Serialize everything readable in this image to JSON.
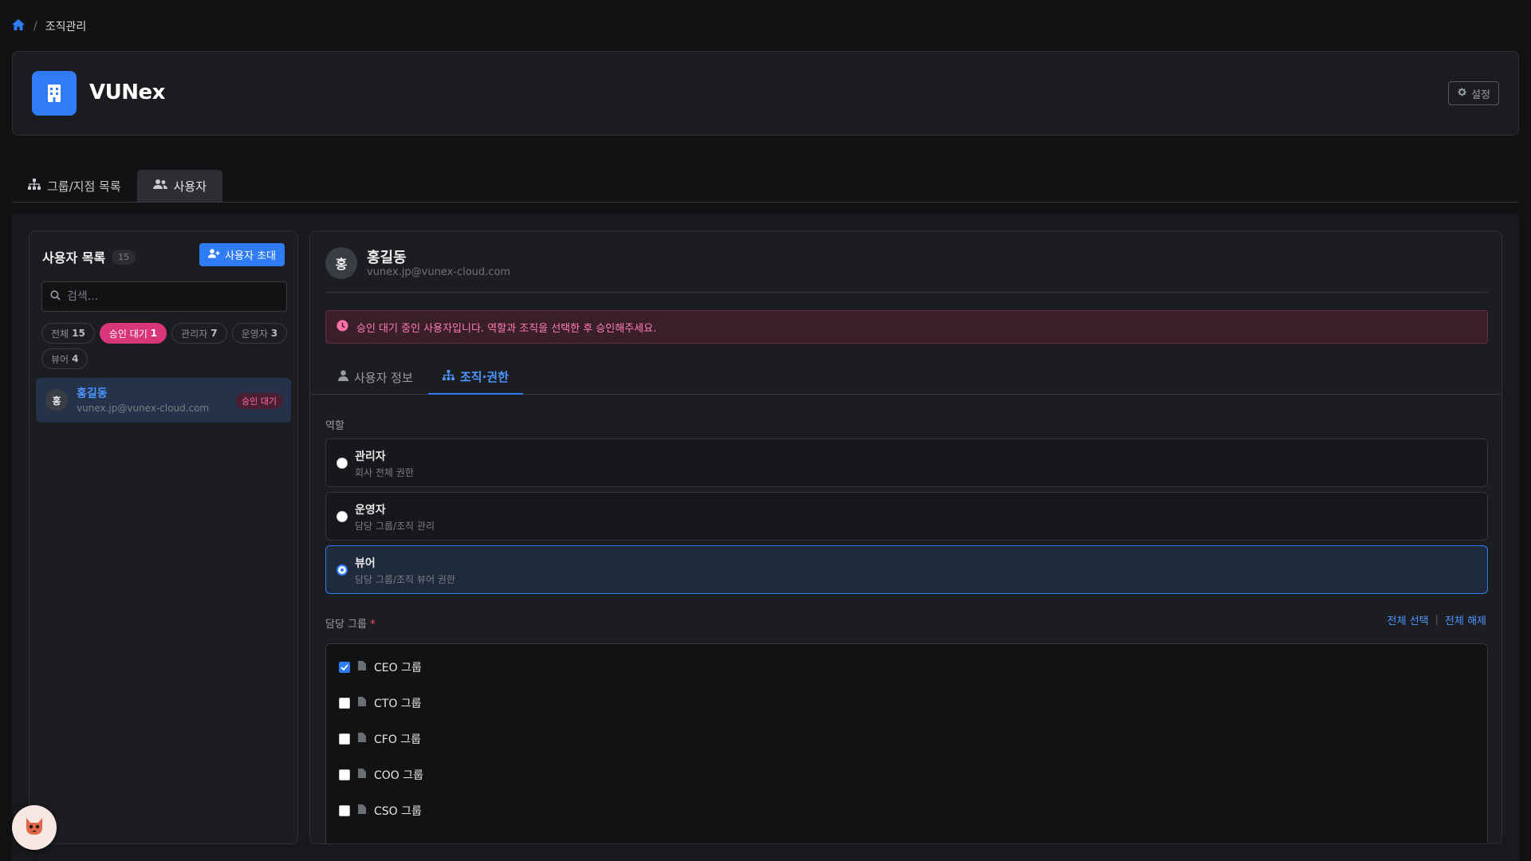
{
  "breadcrumb": {
    "separator": "/",
    "current": "조직관리"
  },
  "org": {
    "name": "VUNex",
    "settings_label": "설정"
  },
  "tabs": [
    {
      "label": "그룹/지점 목록",
      "icon": "sitemap-icon"
    },
    {
      "label": "사용자",
      "icon": "users-icon"
    }
  ],
  "user_list": {
    "title": "사용자 목록",
    "count": "15",
    "invite_label": "사용자 초대",
    "search_placeholder": "검색...",
    "filters": [
      {
        "label": "전체",
        "count": "15"
      },
      {
        "label": "승인 대기",
        "count": "1"
      },
      {
        "label": "관리자",
        "count": "7"
      },
      {
        "label": "운영자",
        "count": "3"
      },
      {
        "label": "뷰어",
        "count": "4"
      }
    ],
    "items": [
      {
        "avatar": "홍",
        "name": "홍길동",
        "email": "vunex.jp@vunex-cloud.com",
        "badge": "승인 대기"
      }
    ]
  },
  "detail": {
    "avatar": "홍",
    "name": "홍길동",
    "email": "vunex.jp@vunex-cloud.com",
    "alert": "승인 대기 중인 사용자입니다. 역할과 조직을 선택한 후 승인해주세요.",
    "tabs": [
      {
        "label": "사용자 정보"
      },
      {
        "label": "조직·권한"
      }
    ],
    "role_label": "역할",
    "roles": [
      {
        "title": "관리자",
        "desc": "회사 전체 권한",
        "selected": false
      },
      {
        "title": "운영자",
        "desc": "담당 그룹/조직 관리",
        "selected": false
      },
      {
        "title": "뷰어",
        "desc": "담당 그룹/조직 뷰어 권한",
        "selected": true
      }
    ],
    "group_label": "담당 그룹",
    "required_mark": "*",
    "select_all": "전체 선택",
    "deselect_all": "전체 해제",
    "link_separator": "|",
    "groups": [
      {
        "name": "CEO 그룹",
        "checked": true
      },
      {
        "name": "CTO 그룹",
        "checked": false
      },
      {
        "name": "CFO 그룹",
        "checked": false
      },
      {
        "name": "COO 그룹",
        "checked": false
      },
      {
        "name": "CSO 그룹",
        "checked": false
      }
    ]
  },
  "colors": {
    "accent": "#2f7cf6",
    "pending": "#d9357a",
    "background": "#111214"
  }
}
